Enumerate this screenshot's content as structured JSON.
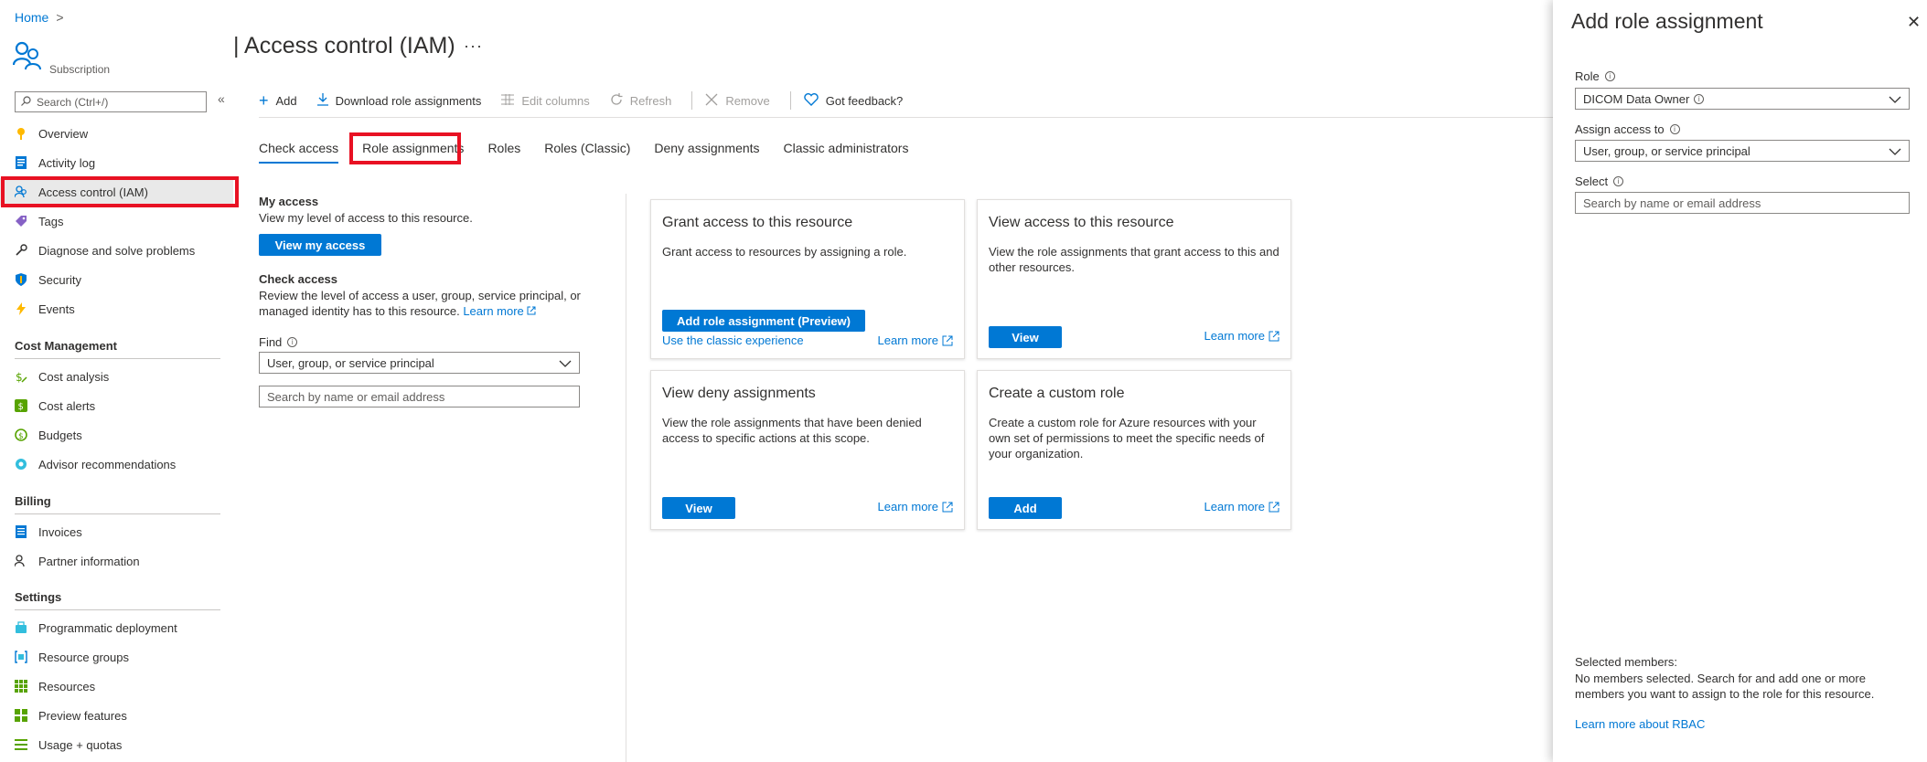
{
  "breadcrumb": {
    "home": "Home",
    "sep": ">"
  },
  "header": {
    "resource_type": "Subscription",
    "title": "| Access control (IAM)",
    "more": "···"
  },
  "sidebar": {
    "search_placeholder": "Search (Ctrl+/)",
    "collapse": "«",
    "items": [
      {
        "label": "Overview"
      },
      {
        "label": "Activity log"
      },
      {
        "label": "Access control (IAM)"
      },
      {
        "label": "Tags"
      },
      {
        "label": "Diagnose and solve problems"
      },
      {
        "label": "Security"
      },
      {
        "label": "Events"
      }
    ],
    "sections": [
      {
        "title": "Cost Management",
        "items": [
          {
            "label": "Cost analysis"
          },
          {
            "label": "Cost alerts"
          },
          {
            "label": "Budgets"
          },
          {
            "label": "Advisor recommendations"
          }
        ]
      },
      {
        "title": "Billing",
        "items": [
          {
            "label": "Invoices"
          },
          {
            "label": "Partner information"
          }
        ]
      },
      {
        "title": "Settings",
        "items": [
          {
            "label": "Programmatic deployment"
          },
          {
            "label": "Resource groups"
          },
          {
            "label": "Resources"
          },
          {
            "label": "Preview features"
          },
          {
            "label": "Usage + quotas"
          }
        ]
      }
    ]
  },
  "toolbar": {
    "add": "Add",
    "download": "Download role assignments",
    "edit_columns": "Edit columns",
    "refresh": "Refresh",
    "remove": "Remove",
    "feedback": "Got feedback?"
  },
  "tabs": [
    "Check access",
    "Role assignments",
    "Roles",
    "Roles (Classic)",
    "Deny assignments",
    "Classic administrators"
  ],
  "my_access": {
    "title": "My access",
    "text": "View my level of access to this resource.",
    "button": "View my access"
  },
  "check_access": {
    "title": "Check access",
    "text": "Review the level of access a user, group, service principal, or managed identity has to this resource.",
    "learn_more": "Learn more",
    "find_label": "Find",
    "find_value": "User, group, or service principal",
    "search_placeholder": "Search by name or email address"
  },
  "cards": {
    "grant": {
      "title": "Grant access to this resource",
      "text": "Grant access to resources by assigning a role.",
      "button": "Add role assignment (Preview)",
      "classic_link": "Use the classic experience",
      "learn_more": "Learn more"
    },
    "view": {
      "title": "View access to this resource",
      "text": "View the role assignments that grant access to this and other resources.",
      "button": "View",
      "learn_more": "Learn more"
    },
    "deny": {
      "title": "View deny assignments",
      "text": "View the role assignments that have been denied access to specific actions at this scope.",
      "button": "View",
      "learn_more": "Learn more"
    },
    "custom": {
      "title": "Create a custom role",
      "text": "Create a custom role for Azure resources with your own set of permissions to meet the specific needs of your organization.",
      "button": "Add",
      "learn_more": "Learn more"
    }
  },
  "panel": {
    "title": "Add role assignment",
    "close": "✕",
    "role_label": "Role",
    "role_value": "DICOM Data Owner",
    "assign_label": "Assign access to",
    "assign_value": "User, group, or service principal",
    "select_label": "Select",
    "select_placeholder": "Search by name or email address",
    "selected_title": "Selected members:",
    "selected_text": "No members selected. Search for and add one or more members you want to assign to the role for this resource.",
    "learn_more": "Learn more about RBAC"
  },
  "colors": {
    "accent": "#0078d4",
    "highlight": "#e81123"
  }
}
